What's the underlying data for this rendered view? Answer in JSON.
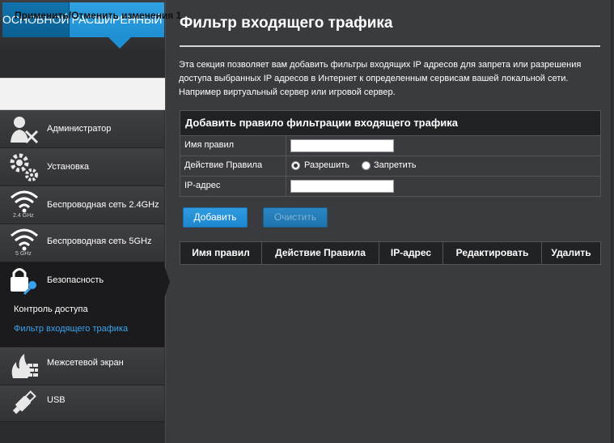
{
  "tabs": {
    "basic": "ОСНОВНОЙ",
    "advanced": "РАСШИРЕННЫЙ"
  },
  "apply_changes": "Применить/Отменить изменения",
  "apply_badge": "1",
  "nav": {
    "admin": "Администратор",
    "setup": "Установка",
    "wireless24": "Беспроводная сеть 2.4GHz",
    "wireless24_band": "2.4 GHz",
    "wireless5": "Беспроводная сеть 5GHz",
    "wireless5_band": "5 GHz",
    "security": "Безопасность",
    "security_sub": [
      "Контроль доступа",
      "Фильтр входящего трафика"
    ],
    "firewall": "Межсетевой экран",
    "usb": "USB"
  },
  "page": {
    "title": "Фильтр входящего трафика",
    "description": "Эта секция позволяет вам добавить фильтры входящих IP адресов для запрета или разрешения доступа выбранных IP адресов в Интернет к определенным сервисам вашей локальной сети. Например виртуальный сервер или игровой сервер."
  },
  "form": {
    "header": "Добавить правило фильтрации входящего трафика",
    "rule_name_label": "Имя правил",
    "rule_name_value": "",
    "action_label": "Действие Правила",
    "action_options": [
      "Разрешить",
      "Запретить"
    ],
    "action_selected": "Разрешить",
    "ip_label": "IP-адрес",
    "ip_value": ""
  },
  "buttons": {
    "add": "Добавить",
    "clear": "Очистить"
  },
  "rules_table": {
    "columns": [
      "Имя правил",
      "Действие Правила",
      "IP-адрес",
      "Редактировать",
      "Удалить"
    ],
    "rows": []
  },
  "colors": {
    "accent": "#1f8fd3",
    "active_link": "#3aa3f0",
    "background": "#3a3b3e",
    "sidebar": "#2b2c2f"
  }
}
